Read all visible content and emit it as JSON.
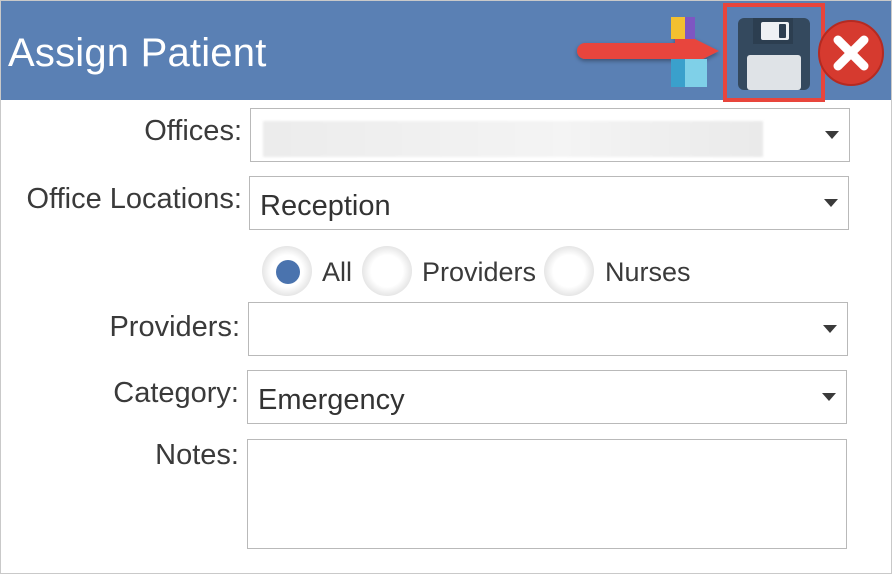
{
  "window": {
    "title": "Assign Patient"
  },
  "toolbar": {
    "icons": [
      "grid-icon",
      "save-icon",
      "close-icon"
    ],
    "highlight_color": "#e8453c",
    "header_color": "#5a80b4"
  },
  "form": {
    "offices": {
      "label": "Offices:",
      "value": ""
    },
    "office_locations": {
      "label": "Office Locations:",
      "value": "Reception"
    },
    "filter": {
      "options": [
        {
          "label": "All",
          "selected": true
        },
        {
          "label": "Providers",
          "selected": false
        },
        {
          "label": "Nurses",
          "selected": false
        }
      ]
    },
    "providers": {
      "label": "Providers:",
      "value": ""
    },
    "category": {
      "label": "Category:",
      "value": "Emergency"
    },
    "notes": {
      "label": "Notes:",
      "value": ""
    }
  }
}
